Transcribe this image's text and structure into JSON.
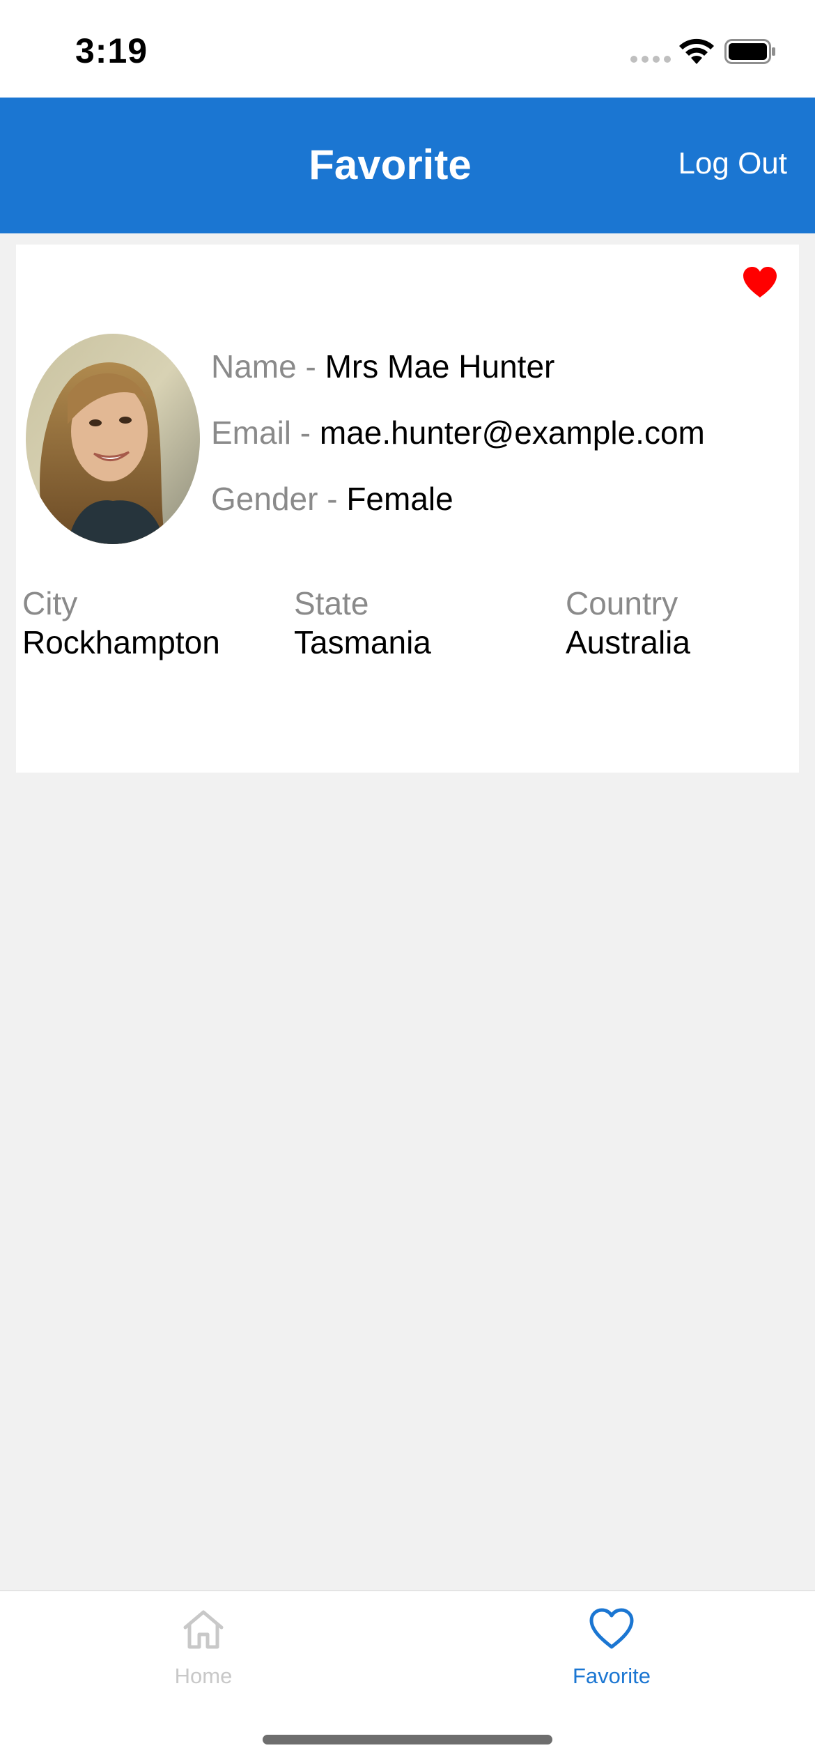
{
  "status_bar": {
    "time": "3:19"
  },
  "header": {
    "title": "Favorite",
    "logout_label": "Log Out",
    "background_color": "#1b76d2"
  },
  "profile": {
    "name_label": "Name - ",
    "name": "Mrs Mae Hunter",
    "email_label": "Email - ",
    "email": "mae.hunter@example.com",
    "gender_label": "Gender - ",
    "gender": "Female",
    "city_label": "City",
    "city": "Rockhampton",
    "state_label": "State",
    "state": "Tasmania",
    "country_label": "Country",
    "country": "Australia",
    "favorite_icon": "heart-filled-icon",
    "favorite_color": "#ff0000"
  },
  "tab_bar": {
    "tabs": [
      {
        "label": "Home",
        "icon": "home-icon",
        "active": false,
        "color": "#c8c8c8"
      },
      {
        "label": "Favorite",
        "icon": "heart-outline-icon",
        "active": true,
        "color": "#1b76d2"
      }
    ]
  }
}
